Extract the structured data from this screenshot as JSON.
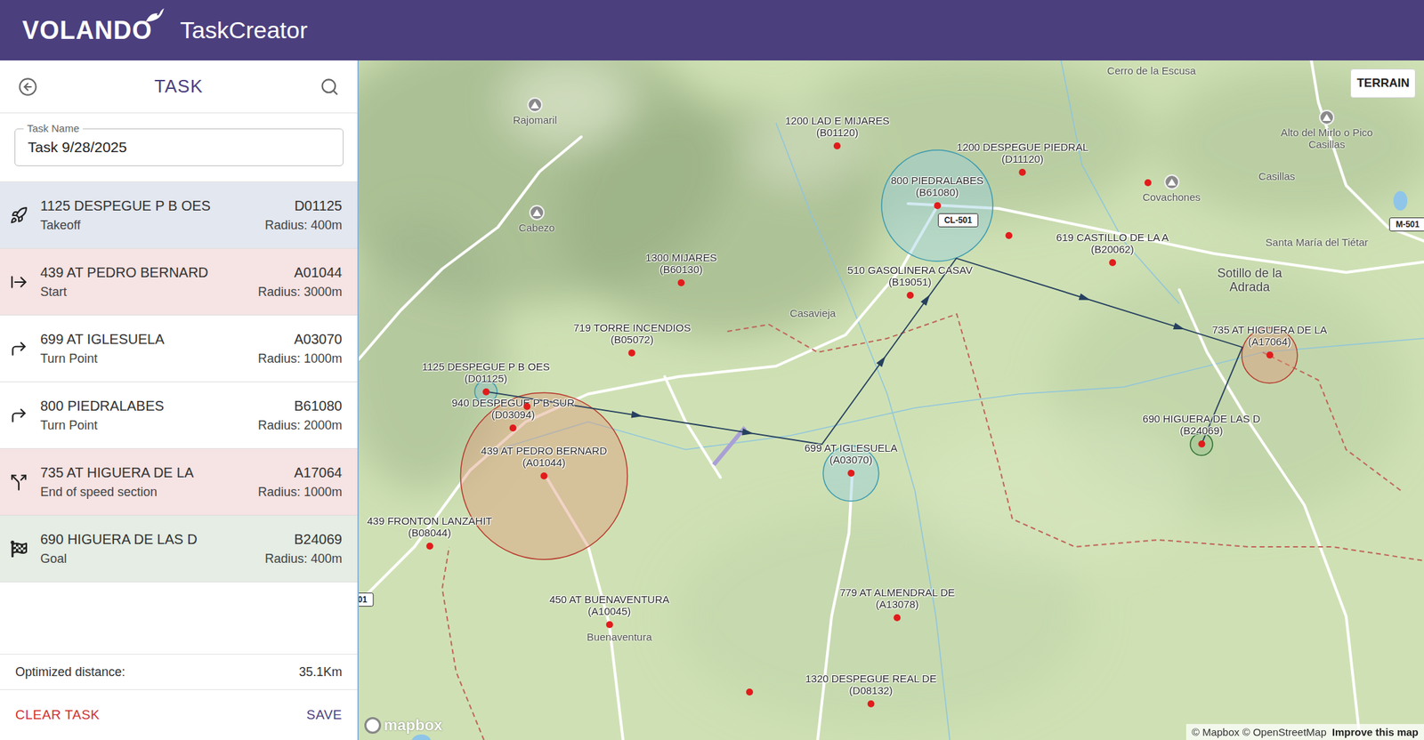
{
  "header": {
    "logo": "VOLANDO",
    "app": "TaskCreator"
  },
  "panel": {
    "title": "TASK",
    "task_name": {
      "label": "Task Name",
      "value": "Task 9/28/2025"
    }
  },
  "task": [
    {
      "name": "1125 DESPEGUE P B OES",
      "id": "D01125",
      "role": "Takeoff",
      "radius": "Radius: 400m",
      "kind": "takeoff"
    },
    {
      "name": "439 AT PEDRO BERNARD",
      "id": "A01044",
      "role": "Start",
      "radius": "Radius: 3000m",
      "kind": "start"
    },
    {
      "name": "699 AT IGLESUELA",
      "id": "A03070",
      "role": "Turn Point",
      "radius": "Radius: 1000m",
      "kind": "turnpoint"
    },
    {
      "name": "800 PIEDRALABES",
      "id": "B61080",
      "role": "Turn Point",
      "radius": "Radius: 2000m",
      "kind": "turnpoint"
    },
    {
      "name": "735 AT HIGUERA DE LA",
      "id": "A17064",
      "role": "End of speed section",
      "radius": "Radius: 1000m",
      "kind": "ess"
    },
    {
      "name": "690 HIGUERA DE LAS D",
      "id": "B24069",
      "role": "Goal",
      "radius": "Radius: 400m",
      "kind": "goal"
    }
  ],
  "summary": {
    "label": "Optimized distance:",
    "value": "35.1Km"
  },
  "actions": [
    {
      "label": "CLEAR TASK",
      "kind": "danger"
    },
    {
      "label": "SAVE",
      "kind": "primary"
    }
  ],
  "map": {
    "terrain_button": "TERRAIN",
    "waypoints": [
      {
        "name": "1125 DESPEGUE P B OES",
        "code": "(D01125)",
        "kind": "labeled"
      },
      {
        "name": "940 DESPEGUE P B SUR",
        "code": "(D03094)",
        "kind": "labeled"
      },
      {
        "name": "439 AT PEDRO BERNARD",
        "code": "(A01044)",
        "kind": "labeled"
      },
      {
        "name": "439 FRONTON LANZAHIT",
        "code": "(B08044)",
        "kind": "labeled"
      },
      {
        "name": "450 AT BUENAVENTURA",
        "code": "(A10045)",
        "kind": "labeled"
      },
      {
        "name": "699 AT IGLESUELA",
        "code": "(A03070)",
        "kind": "labeled"
      },
      {
        "name": "719 TORRE INCENDIOS",
        "code": "(B05072)",
        "kind": "labeled"
      },
      {
        "name": "1300 MIJARES",
        "code": "(B60130)",
        "kind": "labeled"
      },
      {
        "name": "1200 LAD E MIJARES",
        "code": "(B01120)",
        "kind": "labeled"
      },
      {
        "name": "1200 DESPEGUE PIEDRAL",
        "code": "(D11120)",
        "kind": "labeled"
      },
      {
        "name": "800 PIEDRALABES",
        "code": "(B61080)",
        "kind": "labeled"
      },
      {
        "name": "510 GASOLINERA CASAV",
        "code": "(B19051)",
        "kind": "labeled"
      },
      {
        "name": "619 CASTILLO DE LA A",
        "code": "(B20062)",
        "kind": "labeled"
      },
      {
        "name": "735 AT HIGUERA DE LA",
        "code": "(A17064)",
        "kind": "labeled"
      },
      {
        "name": "690 HIGUERA DE LAS D",
        "code": "(B24069)",
        "kind": "labeled"
      },
      {
        "name": "779 AT ALMENDRAL DE",
        "code": "(A13078)",
        "kind": "labeled"
      },
      {
        "name": "1320 DESPEGUE REAL DE",
        "code": "(D08132)",
        "kind": "labeled"
      },
      {
        "name": "",
        "code": "",
        "kind": "dot"
      },
      {
        "name": "",
        "code": "",
        "kind": "dot"
      },
      {
        "name": "",
        "code": "",
        "kind": "dot"
      },
      {
        "name": "",
        "code": "",
        "kind": "dot"
      }
    ],
    "places": [
      {
        "name": "Rajomaril",
        "kind": "peak"
      },
      {
        "name": "Cabezo",
        "kind": "peak"
      },
      {
        "name": "Cerro de la Escusa",
        "kind": "town"
      },
      {
        "name": "Alto del Mirlo o Pico Casillas",
        "kind": "peak"
      },
      {
        "name": "Covachones",
        "kind": "peak"
      },
      {
        "name": "Casillas",
        "kind": "town"
      },
      {
        "name": "Santa María del Tiétar",
        "kind": "town"
      },
      {
        "name": "Sotillo de la Adrada",
        "kind": "city"
      },
      {
        "name": "Casavieja",
        "kind": "town"
      },
      {
        "name": "Buenaventura",
        "kind": "town"
      }
    ],
    "road_signs": [
      "CL-501",
      "M-501",
      "01"
    ],
    "logo": "mapbox",
    "attribution": "© Mapbox © OpenStreetMap",
    "improve": "Improve this map"
  }
}
